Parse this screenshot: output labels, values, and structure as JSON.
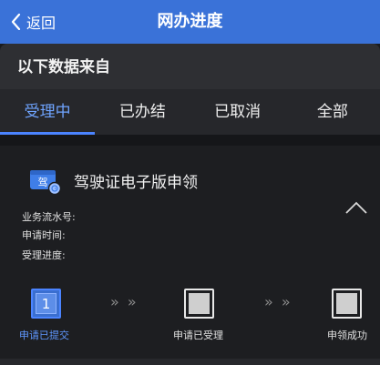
{
  "header": {
    "back_label": "返回",
    "title": "网办进度"
  },
  "source": {
    "label": "以下数据来自"
  },
  "tabs": [
    {
      "label": "受理中",
      "active": true
    },
    {
      "label": "已办结",
      "active": false
    },
    {
      "label": "已取消",
      "active": false
    },
    {
      "label": "全部",
      "active": false
    }
  ],
  "card": {
    "icon_char": "驾",
    "title": "驾驶证电子版申领",
    "fields": {
      "serial": "业务流水号:",
      "apply_time": "申请时间:",
      "progress": "受理进度:"
    }
  },
  "steps": [
    {
      "number": "1",
      "label": "申请已提交",
      "state": "active"
    },
    {
      "number": "",
      "label": "申请已受理",
      "state": "pending"
    },
    {
      "number": "",
      "label": "申领成功",
      "state": "pending"
    }
  ],
  "step_separator": "» »",
  "colors": {
    "header_bg": "#3a72d8",
    "accent": "#5f97ff",
    "page_bg": "#1a1b1e"
  }
}
